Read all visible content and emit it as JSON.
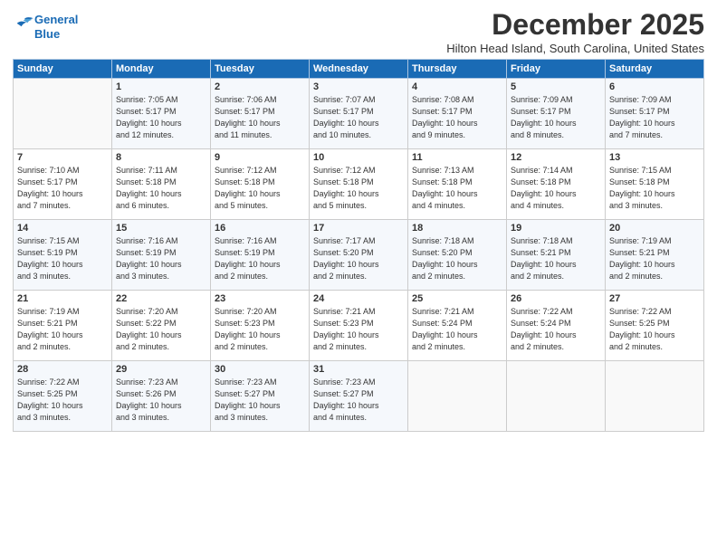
{
  "logo": {
    "line1": "General",
    "line2": "Blue"
  },
  "title": "December 2025",
  "subtitle": "Hilton Head Island, South Carolina, United States",
  "header_days": [
    "Sunday",
    "Monday",
    "Tuesday",
    "Wednesday",
    "Thursday",
    "Friday",
    "Saturday"
  ],
  "weeks": [
    [
      {
        "day": "",
        "info": ""
      },
      {
        "day": "1",
        "info": "Sunrise: 7:05 AM\nSunset: 5:17 PM\nDaylight: 10 hours\nand 12 minutes."
      },
      {
        "day": "2",
        "info": "Sunrise: 7:06 AM\nSunset: 5:17 PM\nDaylight: 10 hours\nand 11 minutes."
      },
      {
        "day": "3",
        "info": "Sunrise: 7:07 AM\nSunset: 5:17 PM\nDaylight: 10 hours\nand 10 minutes."
      },
      {
        "day": "4",
        "info": "Sunrise: 7:08 AM\nSunset: 5:17 PM\nDaylight: 10 hours\nand 9 minutes."
      },
      {
        "day": "5",
        "info": "Sunrise: 7:09 AM\nSunset: 5:17 PM\nDaylight: 10 hours\nand 8 minutes."
      },
      {
        "day": "6",
        "info": "Sunrise: 7:09 AM\nSunset: 5:17 PM\nDaylight: 10 hours\nand 7 minutes."
      }
    ],
    [
      {
        "day": "7",
        "info": "Sunrise: 7:10 AM\nSunset: 5:17 PM\nDaylight: 10 hours\nand 7 minutes."
      },
      {
        "day": "8",
        "info": "Sunrise: 7:11 AM\nSunset: 5:18 PM\nDaylight: 10 hours\nand 6 minutes."
      },
      {
        "day": "9",
        "info": "Sunrise: 7:12 AM\nSunset: 5:18 PM\nDaylight: 10 hours\nand 5 minutes."
      },
      {
        "day": "10",
        "info": "Sunrise: 7:12 AM\nSunset: 5:18 PM\nDaylight: 10 hours\nand 5 minutes."
      },
      {
        "day": "11",
        "info": "Sunrise: 7:13 AM\nSunset: 5:18 PM\nDaylight: 10 hours\nand 4 minutes."
      },
      {
        "day": "12",
        "info": "Sunrise: 7:14 AM\nSunset: 5:18 PM\nDaylight: 10 hours\nand 4 minutes."
      },
      {
        "day": "13",
        "info": "Sunrise: 7:15 AM\nSunset: 5:18 PM\nDaylight: 10 hours\nand 3 minutes."
      }
    ],
    [
      {
        "day": "14",
        "info": "Sunrise: 7:15 AM\nSunset: 5:19 PM\nDaylight: 10 hours\nand 3 minutes."
      },
      {
        "day": "15",
        "info": "Sunrise: 7:16 AM\nSunset: 5:19 PM\nDaylight: 10 hours\nand 3 minutes."
      },
      {
        "day": "16",
        "info": "Sunrise: 7:16 AM\nSunset: 5:19 PM\nDaylight: 10 hours\nand 2 minutes."
      },
      {
        "day": "17",
        "info": "Sunrise: 7:17 AM\nSunset: 5:20 PM\nDaylight: 10 hours\nand 2 minutes."
      },
      {
        "day": "18",
        "info": "Sunrise: 7:18 AM\nSunset: 5:20 PM\nDaylight: 10 hours\nand 2 minutes."
      },
      {
        "day": "19",
        "info": "Sunrise: 7:18 AM\nSunset: 5:21 PM\nDaylight: 10 hours\nand 2 minutes."
      },
      {
        "day": "20",
        "info": "Sunrise: 7:19 AM\nSunset: 5:21 PM\nDaylight: 10 hours\nand 2 minutes."
      }
    ],
    [
      {
        "day": "21",
        "info": "Sunrise: 7:19 AM\nSunset: 5:21 PM\nDaylight: 10 hours\nand 2 minutes."
      },
      {
        "day": "22",
        "info": "Sunrise: 7:20 AM\nSunset: 5:22 PM\nDaylight: 10 hours\nand 2 minutes."
      },
      {
        "day": "23",
        "info": "Sunrise: 7:20 AM\nSunset: 5:23 PM\nDaylight: 10 hours\nand 2 minutes."
      },
      {
        "day": "24",
        "info": "Sunrise: 7:21 AM\nSunset: 5:23 PM\nDaylight: 10 hours\nand 2 minutes."
      },
      {
        "day": "25",
        "info": "Sunrise: 7:21 AM\nSunset: 5:24 PM\nDaylight: 10 hours\nand 2 minutes."
      },
      {
        "day": "26",
        "info": "Sunrise: 7:22 AM\nSunset: 5:24 PM\nDaylight: 10 hours\nand 2 minutes."
      },
      {
        "day": "27",
        "info": "Sunrise: 7:22 AM\nSunset: 5:25 PM\nDaylight: 10 hours\nand 2 minutes."
      }
    ],
    [
      {
        "day": "28",
        "info": "Sunrise: 7:22 AM\nSunset: 5:25 PM\nDaylight: 10 hours\nand 3 minutes."
      },
      {
        "day": "29",
        "info": "Sunrise: 7:23 AM\nSunset: 5:26 PM\nDaylight: 10 hours\nand 3 minutes."
      },
      {
        "day": "30",
        "info": "Sunrise: 7:23 AM\nSunset: 5:27 PM\nDaylight: 10 hours\nand 3 minutes."
      },
      {
        "day": "31",
        "info": "Sunrise: 7:23 AM\nSunset: 5:27 PM\nDaylight: 10 hours\nand 4 minutes."
      },
      {
        "day": "",
        "info": ""
      },
      {
        "day": "",
        "info": ""
      },
      {
        "day": "",
        "info": ""
      }
    ]
  ]
}
